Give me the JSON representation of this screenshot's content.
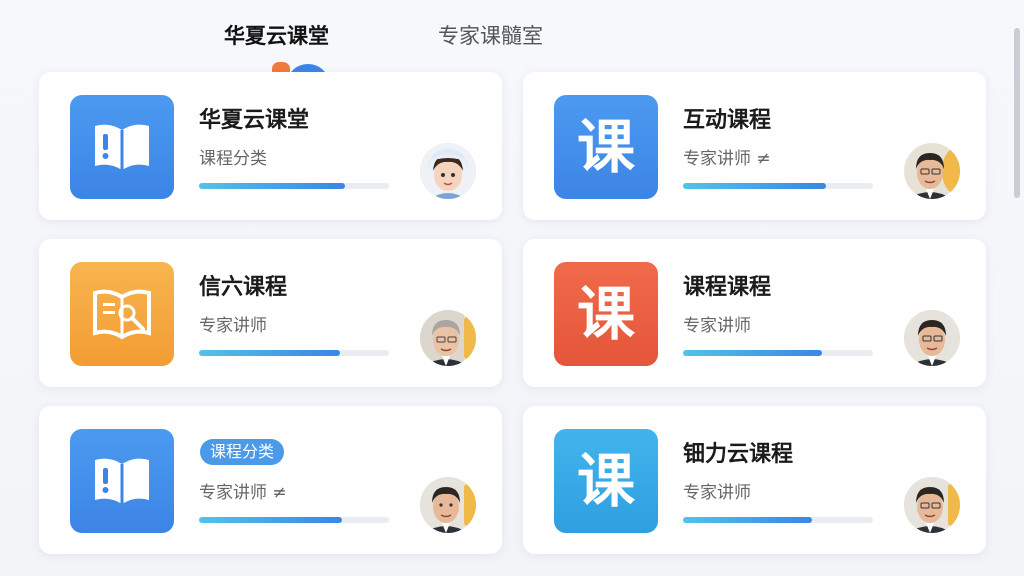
{
  "tabs": [
    {
      "label": "华夏云课堂",
      "active": true
    },
    {
      "label": "专家课髓室",
      "active": false
    }
  ],
  "cards": [
    {
      "title": "华夏云课堂",
      "subtitle": "课程分类",
      "thumb": "book-icon",
      "thumb_color": "#3c84e6",
      "progress": 0.77,
      "avatar": "female-teacher-avatar"
    },
    {
      "title": "互动课程",
      "subtitle": "专家讲师 ≠",
      "thumb_glyph": "课",
      "thumb_color": "#3c84e6",
      "progress": 0.75,
      "avatar": "male-teacher-avatar"
    },
    {
      "title": "信六课程",
      "subtitle": "专家讲师",
      "thumb": "book-gear-icon",
      "thumb_color": "#f39c33",
      "progress": 0.74,
      "avatar": "older-teacher-avatar"
    },
    {
      "title": "课程课程",
      "subtitle": "专家讲师",
      "thumb_glyph": "课",
      "thumb_color": "#e5553a",
      "progress": 0.73,
      "avatar": "male-teacher-avatar"
    },
    {
      "badge": "课程分类",
      "subtitle": "专家讲师 ≠",
      "thumb": "book-icon",
      "thumb_color": "#3c84e6",
      "progress": 0.75,
      "avatar": "male-teacher-avatar"
    },
    {
      "title": "钿力云课程",
      "subtitle": "专家讲师",
      "thumb_glyph": "课",
      "thumb_color": "#2e9fe0",
      "progress": 0.68,
      "avatar": "male-teacher-avatar"
    }
  ]
}
